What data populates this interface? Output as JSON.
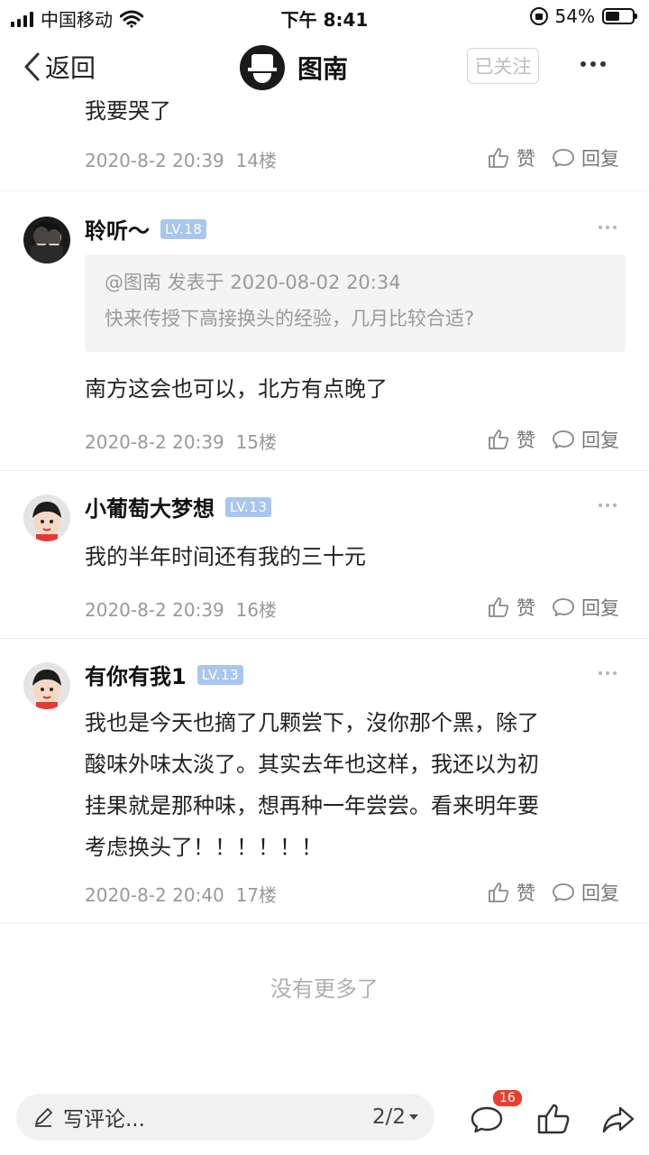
{
  "status_bar": {
    "carrier": "中国移动",
    "time": "下午 8:41",
    "battery": "54%",
    "battery_level": 0.54
  },
  "nav": {
    "back_label": "返回",
    "title": "图南",
    "follow_label": "已关注"
  },
  "comments": [
    {
      "text": "我要哭了",
      "date": "2020-8-2 20:39",
      "floor": "14楼"
    },
    {
      "username": "聆听～",
      "level": "LV.18",
      "quote_meta": "@图南 发表于 2020-08-02 20:34",
      "quote_text": "快来传授下高接换头的经验，几月比较合适?",
      "text": "南方这会也可以，北方有点晚了",
      "date": "2020-8-2 20:39",
      "floor": "15楼"
    },
    {
      "username": "小葡萄大梦想",
      "level": "LV.13",
      "text": "我的半年时间还有我的三十元",
      "date": "2020-8-2 20:39",
      "floor": "16楼"
    },
    {
      "username": "有你有我1",
      "level": "LV.13",
      "text_lines": [
        "我也是今天也摘了几颗尝下，沒你那个黑，除了",
        "酸味外味太淡了。其实去年也这样，我还以为初",
        "挂果就是那种味，想再种一年尝尝。看来明年要",
        "考虑换头了！！！！！！"
      ],
      "date": "2020-8-2 20:40",
      "floor": "17楼"
    }
  ],
  "actions": {
    "like_label": "赞",
    "reply_label": "回复"
  },
  "no_more_text": "没有更多了",
  "bottom_bar": {
    "write_placeholder": "写评论...",
    "page_indicator": "2/2",
    "comment_badge": "16"
  },
  "colors": {
    "level_badge": "#a9c6ef",
    "notification_badge": "#e8402f"
  }
}
